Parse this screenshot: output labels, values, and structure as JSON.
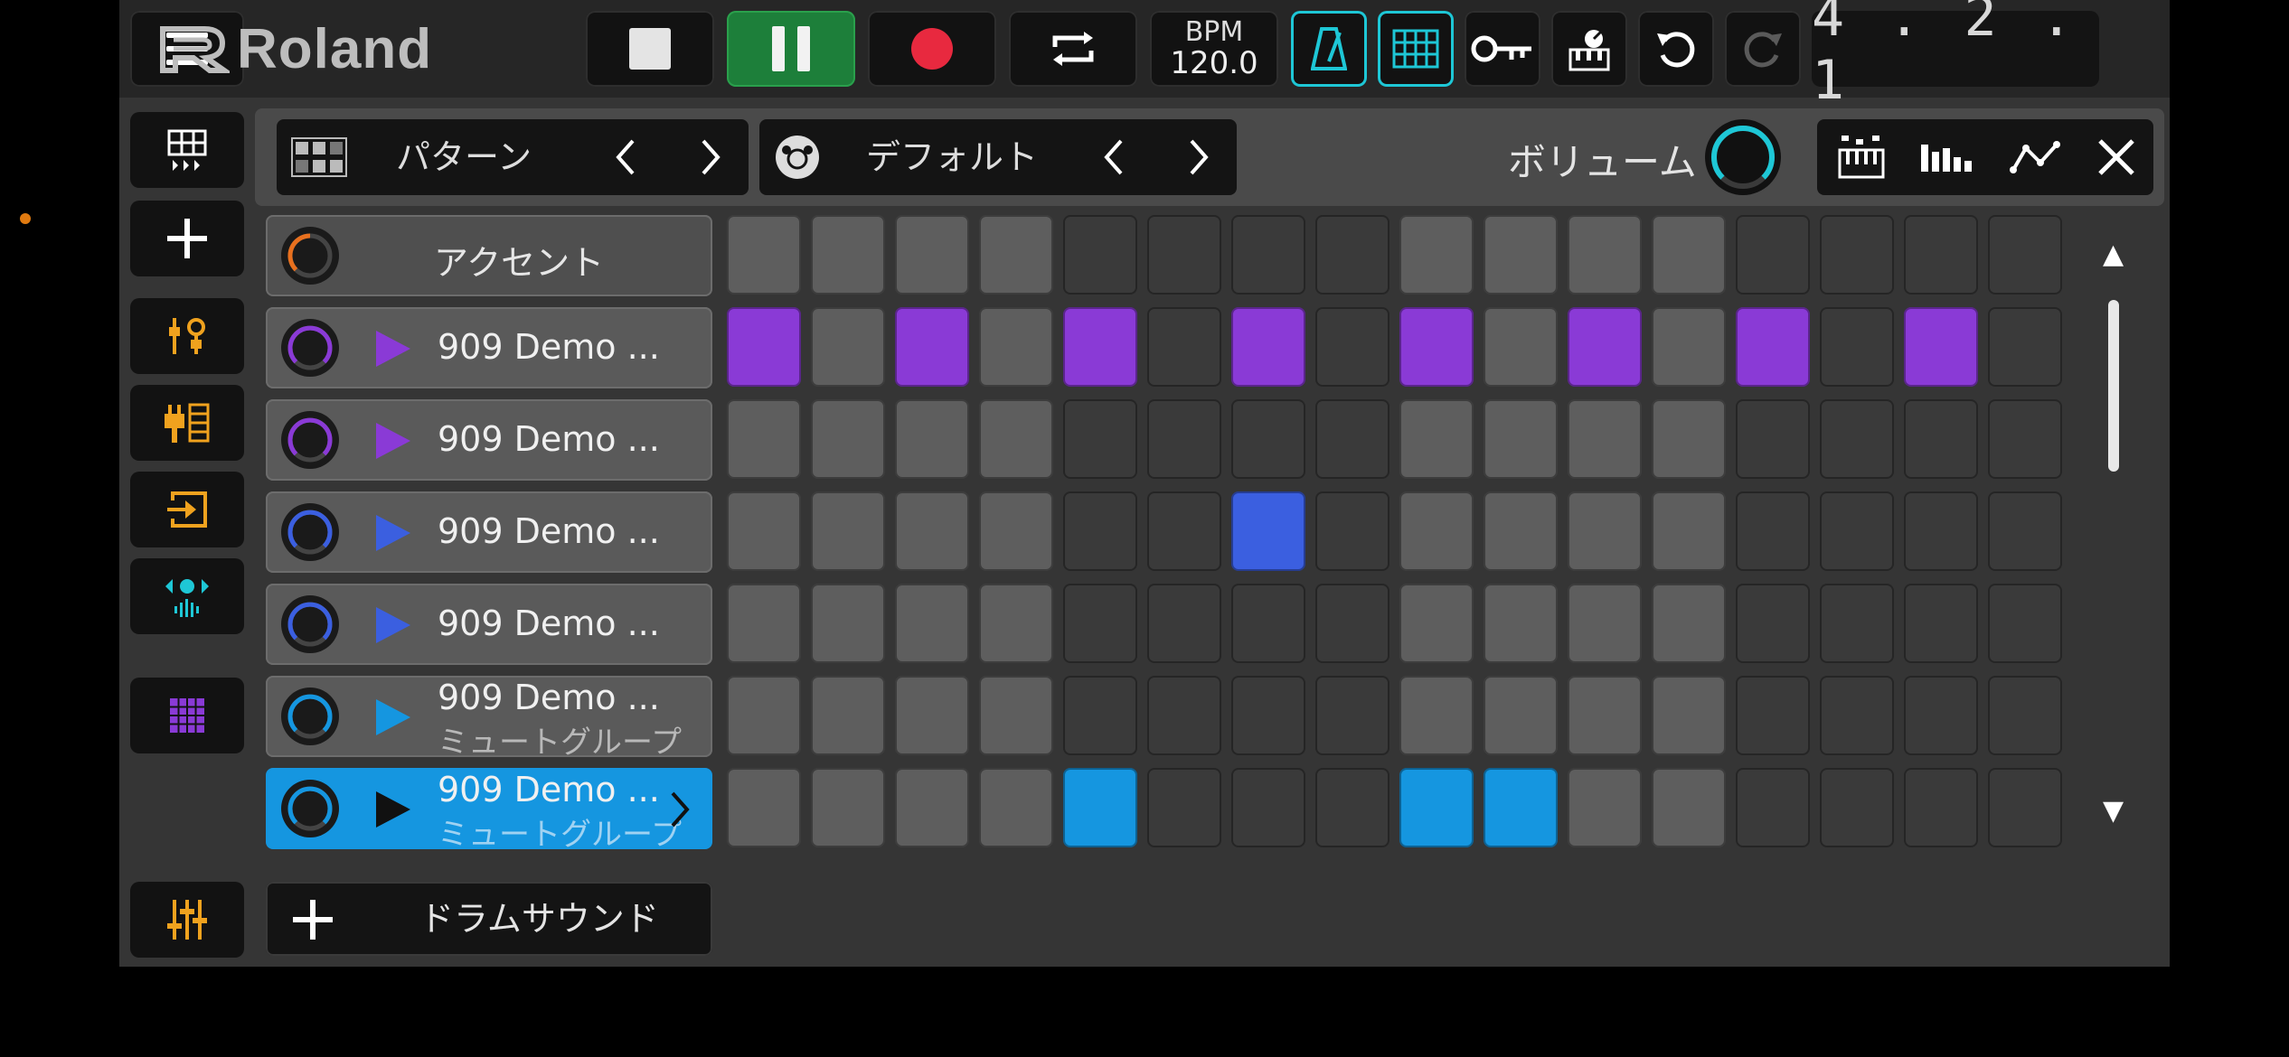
{
  "colors": {
    "purple": "#8a3ad6",
    "blue": "#3b5fe0",
    "cyan": "#1596e0",
    "pad_light": "#5e5e5e",
    "pad_dark": "#3a3a3a",
    "accent_orange": "#f0a21e",
    "toggle_cyan": "#1ec7d6",
    "record_red": "#e8293f"
  },
  "header": {
    "brand": "Roland",
    "bpm_label": "BPM",
    "bpm_value": "120.0",
    "position": "4 . 2 . 1",
    "icons": [
      "menu-icon",
      "stop-icon",
      "pause-icon",
      "record-icon",
      "loop-icon",
      "metronome-icon",
      "grid-icon",
      "key-icon",
      "piano-fx-icon",
      "undo-icon",
      "redo-icon"
    ]
  },
  "sidebar": {
    "icons": [
      "pattern-view-icon",
      "add-icon",
      "tone-edit-icon",
      "plug-in-icon",
      "import-icon",
      "sound-wave-icon",
      "pad-grid-icon",
      "mixer-icon"
    ]
  },
  "pattern_bar": {
    "pattern_label": "パターン",
    "kit_label": "デフォルト",
    "volume_label": "ボリューム"
  },
  "tracks": {
    "accent_label": "アクセント",
    "rows": [
      {
        "name": "909 Demo ...",
        "sub": ""
      },
      {
        "name": "909 Demo ...",
        "sub": ""
      },
      {
        "name": "909 Demo ...",
        "sub": ""
      },
      {
        "name": "909 Demo ...",
        "sub": ""
      },
      {
        "name": "909 Demo ...",
        "sub": "ミュートグループ"
      },
      {
        "name": "909 Demo ...",
        "sub": "ミュートグループ"
      }
    ]
  },
  "grid": {
    "steps": 16,
    "rows": [
      {
        "color": "none",
        "on": []
      },
      {
        "color": "purple",
        "on": [
          0,
          2,
          4,
          6,
          8,
          10,
          12,
          14
        ]
      },
      {
        "color": "purple",
        "on": []
      },
      {
        "color": "blue",
        "on": [
          6
        ]
      },
      {
        "color": "blue",
        "on": []
      },
      {
        "color": "cyan",
        "on": []
      },
      {
        "color": "cyan",
        "on": [
          4,
          8,
          9
        ]
      }
    ]
  },
  "add_drum_label": "ドラムサウンド"
}
